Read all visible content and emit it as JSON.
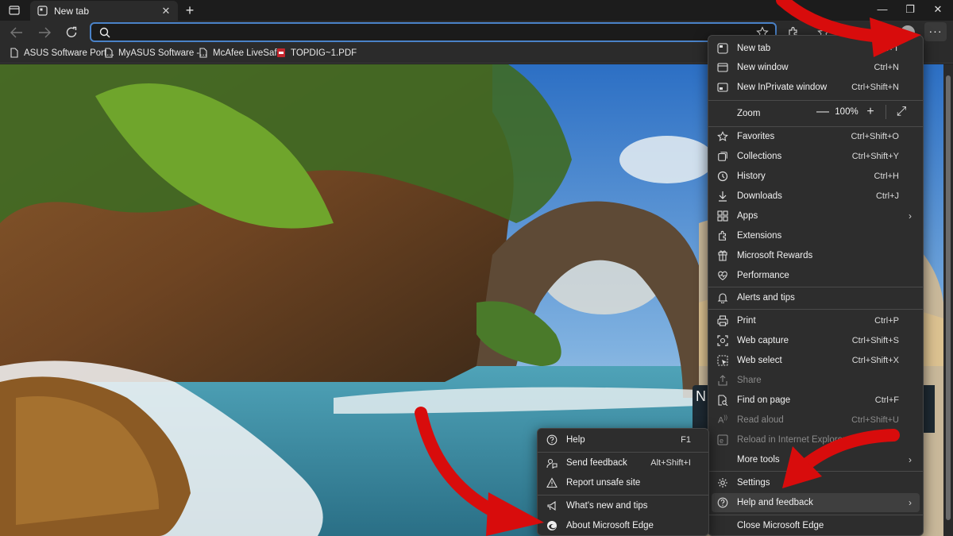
{
  "window": {
    "tab_title": "New tab",
    "new_tab_symbol": "+",
    "close_symbol": "✕",
    "minimize_symbol": "—",
    "restore_symbol": "❐",
    "close_window_symbol": "✕"
  },
  "toolbar": {
    "address_value": "",
    "more_label": "···"
  },
  "bookmarks": [
    {
      "label": "ASUS Software Port...",
      "icon": "file-icon"
    },
    {
      "label": "MyASUS Software -...",
      "icon": "file-icon"
    },
    {
      "label": "McAfee LiveSafe",
      "icon": "file-icon"
    },
    {
      "label": "TOPDIG~1.PDF",
      "icon": "pdf-icon"
    }
  ],
  "main_menu": {
    "items": [
      {
        "label": "New tab",
        "shortcut": "Ctrl+T",
        "icon": "new-tab-icon"
      },
      {
        "label": "New window",
        "shortcut": "Ctrl+N",
        "icon": "new-window-icon"
      },
      {
        "label": "New InPrivate window",
        "shortcut": "Ctrl+Shift+N",
        "icon": "inprivate-icon"
      },
      {
        "label": "Zoom",
        "value": "100%",
        "minus": "—",
        "plus": "+",
        "expand": "⤢"
      },
      {
        "label": "Favorites",
        "shortcut": "Ctrl+Shift+O",
        "icon": "star-icon"
      },
      {
        "label": "Collections",
        "shortcut": "Ctrl+Shift+Y",
        "icon": "collections-icon"
      },
      {
        "label": "History",
        "shortcut": "Ctrl+H",
        "icon": "history-icon"
      },
      {
        "label": "Downloads",
        "shortcut": "Ctrl+J",
        "icon": "download-icon"
      },
      {
        "label": "Apps",
        "shortcut": "",
        "icon": "apps-icon",
        "submenu": true
      },
      {
        "label": "Extensions",
        "shortcut": "",
        "icon": "puzzle-icon"
      },
      {
        "label": "Microsoft Rewards",
        "shortcut": "",
        "icon": "rewards-icon"
      },
      {
        "label": "Performance",
        "shortcut": "",
        "icon": "heart-pulse-icon"
      },
      {
        "label": "Alerts and tips",
        "shortcut": "",
        "icon": "bell-icon"
      },
      {
        "label": "Print",
        "shortcut": "Ctrl+P",
        "icon": "printer-icon"
      },
      {
        "label": "Web capture",
        "shortcut": "Ctrl+Shift+S",
        "icon": "capture-icon"
      },
      {
        "label": "Web select",
        "shortcut": "Ctrl+Shift+X",
        "icon": "select-icon"
      },
      {
        "label": "Share",
        "shortcut": "",
        "icon": "share-icon",
        "disabled": true
      },
      {
        "label": "Find on page",
        "shortcut": "Ctrl+F",
        "icon": "find-icon"
      },
      {
        "label": "Read aloud",
        "shortcut": "Ctrl+Shift+U",
        "icon": "read-aloud-icon",
        "disabled": true
      },
      {
        "label": "Reload in Internet Explorer mode",
        "shortcut": "",
        "icon": "ie-icon",
        "disabled": true
      },
      {
        "label": "More tools",
        "shortcut": "",
        "icon": "",
        "submenu": true
      },
      {
        "label": "Settings",
        "shortcut": "",
        "icon": "gear-icon"
      },
      {
        "label": "Help and feedback",
        "shortcut": "",
        "icon": "help-icon",
        "submenu": true,
        "highlighted": true
      },
      {
        "label": "Close Microsoft Edge",
        "shortcut": "",
        "icon": ""
      }
    ]
  },
  "help_menu": {
    "items": [
      {
        "label": "Help",
        "shortcut": "F1",
        "icon": "help-icon"
      },
      {
        "label": "Send feedback",
        "shortcut": "Alt+Shift+I",
        "icon": "feedback-icon"
      },
      {
        "label": "Report unsafe site",
        "shortcut": "",
        "icon": "warning-icon"
      },
      {
        "label": "What's new and tips",
        "shortcut": "",
        "icon": "megaphone-icon"
      },
      {
        "label": "About Microsoft Edge",
        "shortcut": "",
        "icon": "edge-icon"
      }
    ]
  },
  "colors": {
    "accent_border": "#4a82c8",
    "menu_bg": "#2d2d2d",
    "annotation_arrow": "#e01010"
  }
}
